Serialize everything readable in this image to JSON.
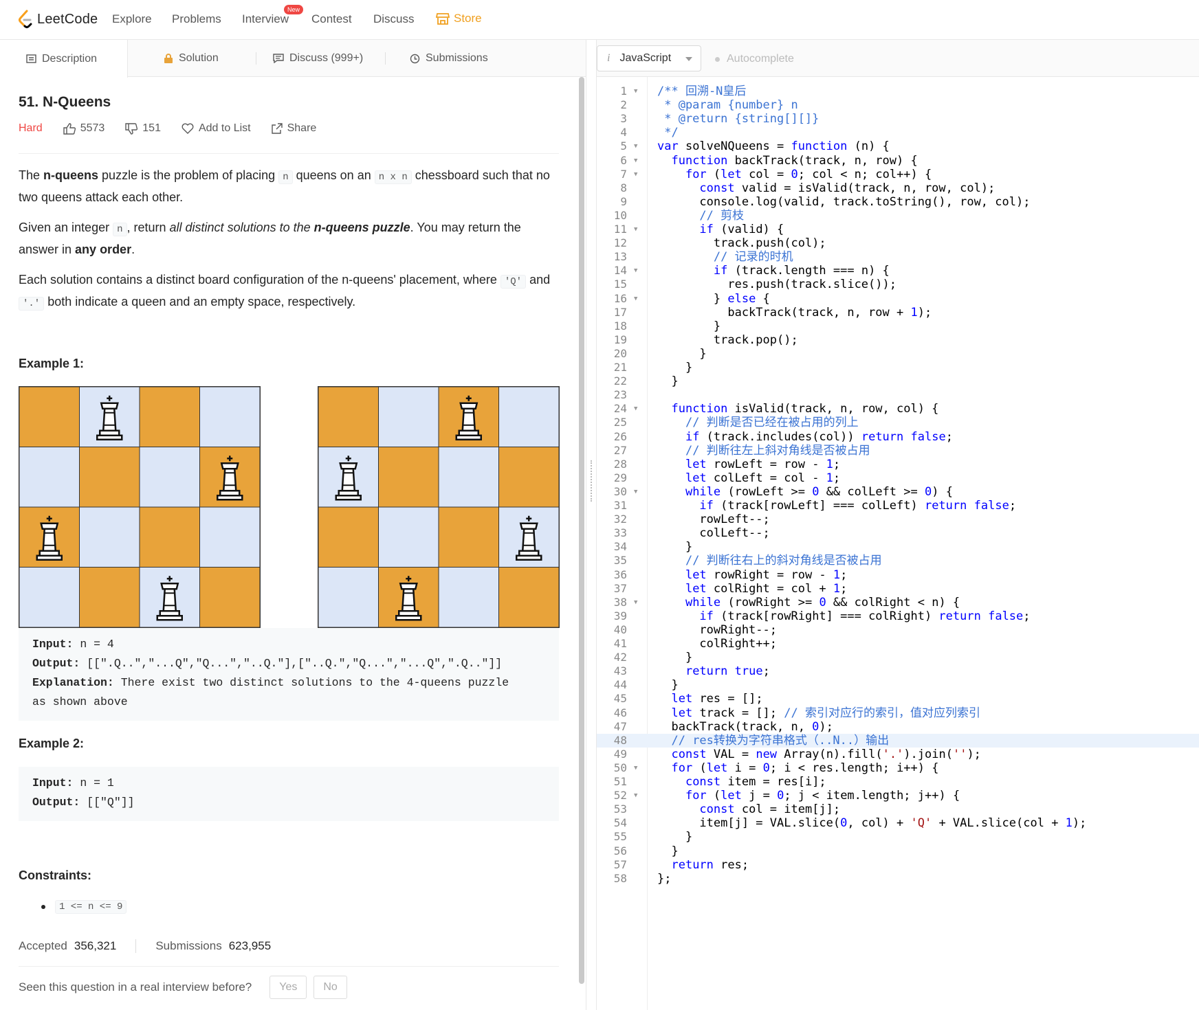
{
  "nav": {
    "logo_text": "LeetCode",
    "items": [
      "Explore",
      "Problems",
      "Interview",
      "Contest",
      "Discuss"
    ],
    "new_badge": "New",
    "store": "Store"
  },
  "tabs": {
    "description": "Description",
    "solution": "Solution",
    "discuss": "Discuss (999+)",
    "submissions": "Submissions"
  },
  "problem": {
    "title": "51. N-Queens",
    "difficulty": "Hard",
    "likes": "5573",
    "dislikes": "151",
    "add_to_list": "Add to List",
    "share": "Share"
  },
  "examples": {
    "ex1_heading": "Example 1:",
    "ex1_input_label": "Input:",
    "ex1_input": " n = 4",
    "ex1_output_label": "Output:",
    "ex1_output": " [[\".Q..\",\"...Q\",\"Q...\",\"..Q.\"],[\"..Q.\",\"Q...\",\"...Q\",\".Q..\"]]",
    "ex1_expl_label": "Explanation:",
    "ex1_expl": " There exist two distinct solutions to the 4-queens puzzle",
    "ex1_expl2": "as shown above",
    "ex2_heading": "Example 2:",
    "ex2_input_label": "Input:",
    "ex2_input": " n = 1",
    "ex2_output_label": "Output:",
    "ex2_output": " [[\"Q\"]]",
    "constraints_heading": "Constraints:",
    "constraint1": "1 <= n <= 9"
  },
  "boards": [
    {
      "queens": [
        1,
        3,
        0,
        2
      ]
    },
    {
      "queens": [
        2,
        0,
        3,
        1
      ]
    }
  ],
  "colors": {
    "dark_square": "#e8a33a",
    "light_square": "#dce6f7"
  },
  "stats": {
    "accepted_label": "Accepted",
    "accepted": "356,321",
    "submissions_label": "Submissions",
    "submissions": "623,955"
  },
  "interview": {
    "question": "Seen this question in a real interview before?",
    "yes": "Yes",
    "no": "No"
  },
  "editor": {
    "language": "JavaScript",
    "autocomplete": "Autocomplete",
    "highlighted_line": 48,
    "fold_lines": [
      1,
      5,
      6,
      7,
      11,
      14,
      16,
      24,
      30,
      38,
      50,
      52
    ],
    "lines": [
      "/** 回溯-N皇后",
      " * @param {number} n",
      " * @return {string[][]}",
      " */",
      "var solveNQueens = function (n) {",
      "  function backTrack(track, n, row) {",
      "    for (let col = 0; col < n; col++) {",
      "      const valid = isValid(track, n, row, col);",
      "      console.log(valid, track.toString(), row, col);",
      "      // 剪枝",
      "      if (valid) {",
      "        track.push(col);",
      "        // 记录的时机",
      "        if (track.length === n) {",
      "          res.push(track.slice());",
      "        } else {",
      "          backTrack(track, n, row + 1);",
      "        }",
      "        track.pop();",
      "      }",
      "    }",
      "  }",
      "",
      "  function isValid(track, n, row, col) {",
      "    // 判断是否已经在被占用的列上",
      "    if (track.includes(col)) return false;",
      "    // 判断往左上斜对角线是否被占用",
      "    let rowLeft = row - 1;",
      "    let colLeft = col - 1;",
      "    while (rowLeft >= 0 && colLeft >= 0) {",
      "      if (track[rowLeft] === colLeft) return false;",
      "      rowLeft--;",
      "      colLeft--;",
      "    }",
      "    // 判断往右上的斜对角线是否被占用",
      "    let rowRight = row - 1;",
      "    let colRight = col + 1;",
      "    while (rowRight >= 0 && colRight < n) {",
      "      if (track[rowRight] === colRight) return false;",
      "      rowRight--;",
      "      colRight++;",
      "    }",
      "    return true;",
      "  }",
      "  let res = [];",
      "  let track = []; // 索引对应行的索引，值对应列索引",
      "  backTrack(track, n, 0);",
      "  // res转换为字符串格式（..N..）输出",
      "  const VAL = new Array(n).fill('.').join('');",
      "  for (let i = 0; i < res.length; i++) {",
      "    const item = res[i];",
      "    for (let j = 0; j < item.length; j++) {",
      "      const col = item[j];",
      "      item[j] = VAL.slice(0, col) + 'Q' + VAL.slice(col + 1);",
      "    }",
      "  }",
      "  return res;",
      "};"
    ]
  }
}
